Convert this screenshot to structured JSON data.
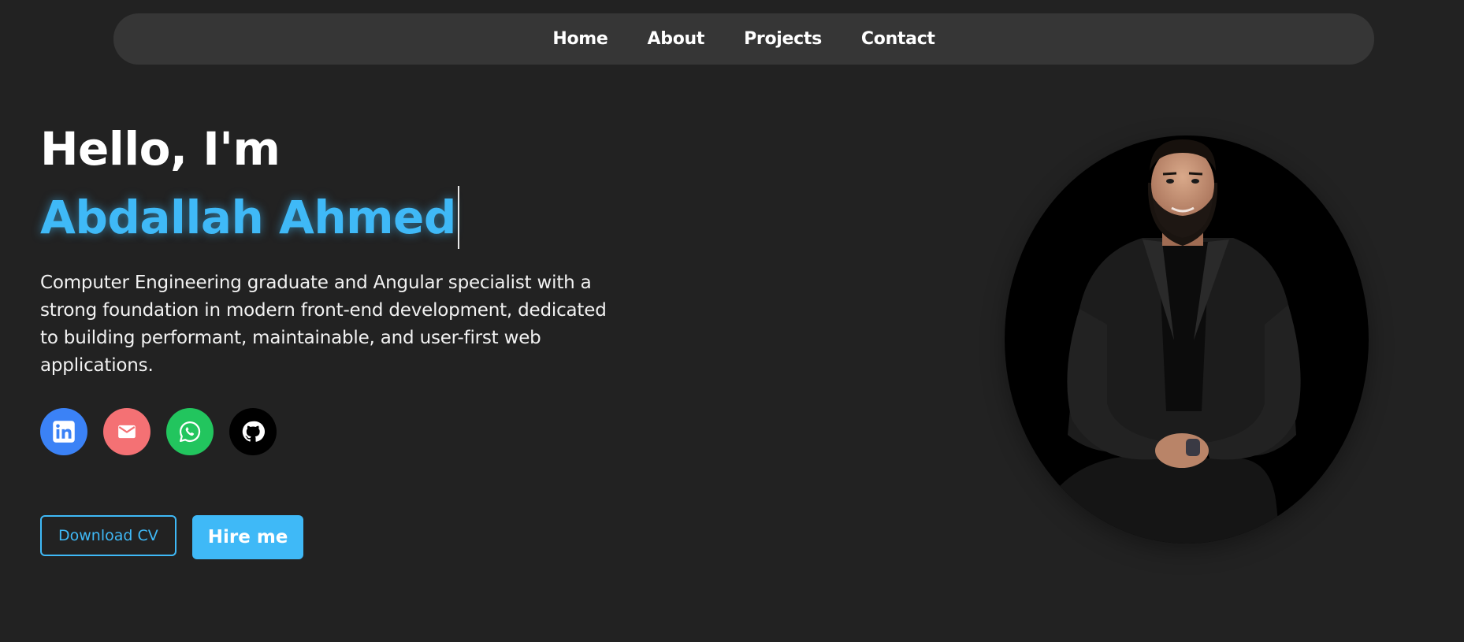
{
  "nav": {
    "items": [
      "Home",
      "About",
      "Projects",
      "Contact"
    ]
  },
  "hero": {
    "greeting": "Hello, I'm",
    "name": "Abdallah Ahmed",
    "bio": "Computer Engineering graduate and Angular specialist with a strong foundation in modern front-end development, dedicated to building performant, maintainable, and user-first web applications."
  },
  "socials": [
    {
      "icon": "linkedin-icon",
      "color": "#3b82f6"
    },
    {
      "icon": "email-icon",
      "color": "#f47174"
    },
    {
      "icon": "whatsapp-icon",
      "color": "#22c55e"
    },
    {
      "icon": "github-icon",
      "color": "#000000"
    }
  ],
  "buttons": {
    "download_cv": "Download CV",
    "hire_me": "Hire me"
  },
  "colors": {
    "background": "#222222",
    "navbar": "#363636",
    "accent": "#3fb9f7"
  }
}
